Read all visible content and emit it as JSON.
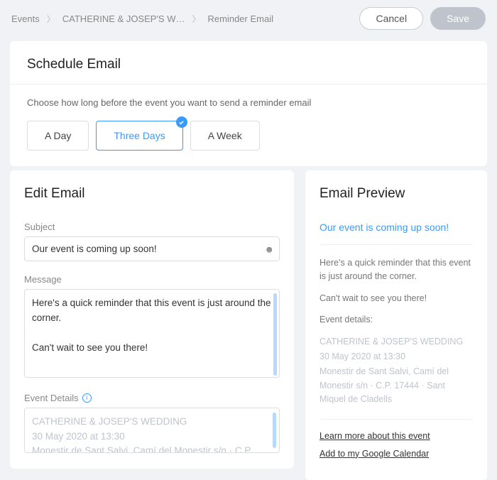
{
  "breadcrumb": {
    "item1": "Events",
    "item2": "CATHERINE & JOSEP'S W…",
    "item3": "Reminder Email"
  },
  "buttons": {
    "cancel": "Cancel",
    "save": "Save"
  },
  "schedule": {
    "title": "Schedule Email",
    "description": "Choose how long before the event you want to send a reminder email",
    "options": {
      "day": "A Day",
      "three": "Three Days",
      "week": "A Week"
    },
    "selected": "three"
  },
  "edit": {
    "title": "Edit Email",
    "subject_label": "Subject",
    "subject_value": "Our event is coming up soon!",
    "message_label": "Message",
    "message_value": "Here's a quick reminder that this event is just around the corner.\n\nCan't wait to see you there!",
    "details_label": "Event Details",
    "details_line1": "CATHERINE & JOSEP'S WEDDING",
    "details_line2": "30 May 2020 at 13:30",
    "details_line3": "Monestir de Sant Salvi, Camí del Monestir s/n · C.P."
  },
  "preview": {
    "title": "Email Preview",
    "subject": "Our event is coming up soon!",
    "body1": "Here's a quick reminder that this event is just around the corner.",
    "body2": "Can't wait to see you there!",
    "body3": "Event details:",
    "d1": "CATHERINE & JOSEP'S WEDDING",
    "d2": "30 May 2020 at 13:30",
    "d3": "Monestir de Sant Salvi, Camí del Monestir s/n · C.P. 17444 · Sant Miquel de Cladells",
    "link1": "Learn more about this event",
    "link2": "Add to my Google Calendar"
  }
}
